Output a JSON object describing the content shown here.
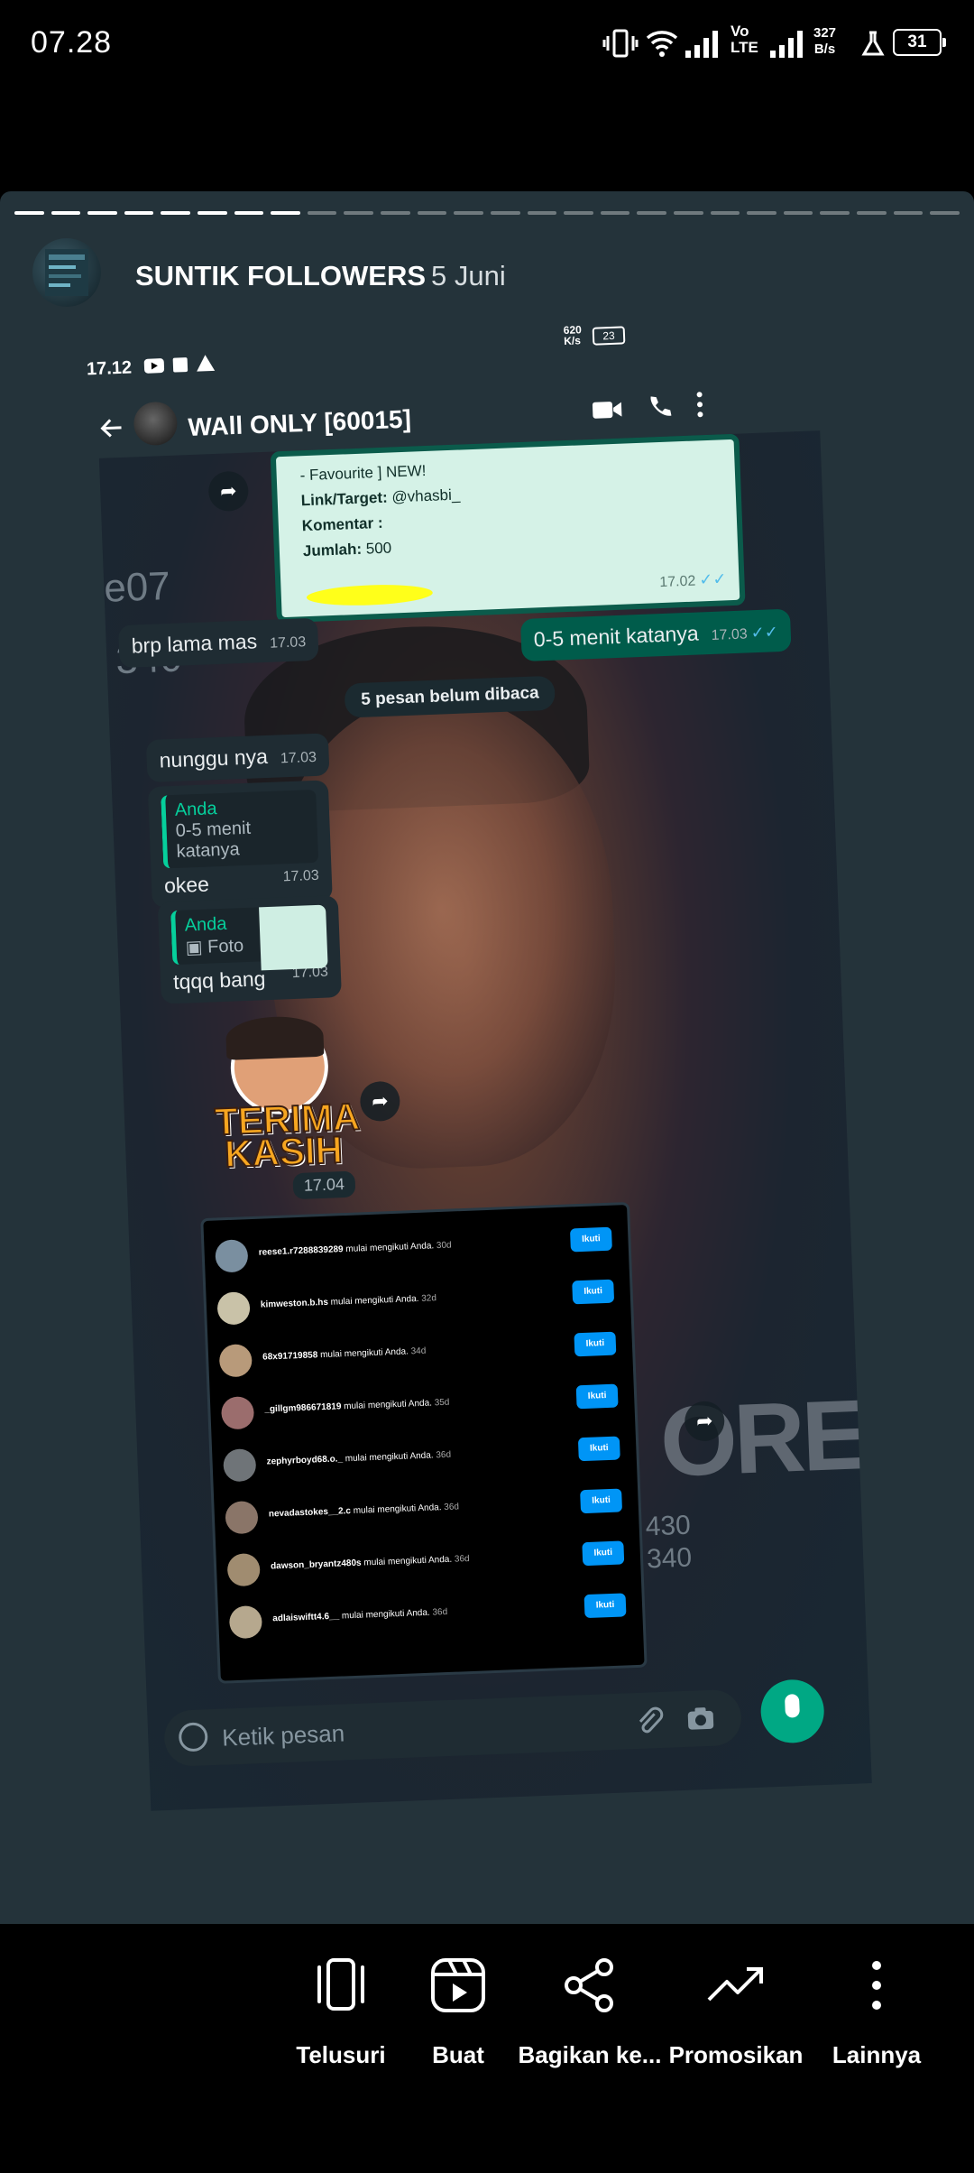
{
  "status_bar": {
    "time": "07.28",
    "net_speed_value": "327",
    "net_speed_unit": "B/s",
    "volte": "Vo\nLTE",
    "battery": "31"
  },
  "story": {
    "progress_total": 26,
    "progress_done": 8,
    "account_name": "SUNTIK FOLLOWERS",
    "date": "5 Juni"
  },
  "shot": {
    "status": {
      "time": "17.12",
      "battery": "23",
      "net_speed": "620\nK/s"
    },
    "chat_title": "WAll ONLY [60015]",
    "form": {
      "line1": "- Favourite ] NEW!",
      "target_label": "Link/Target:",
      "target_value": "@vhasbi_",
      "comment_label": "Komentar :",
      "amount_label": "Jumlah:",
      "amount_value": "500",
      "time": "17.02"
    },
    "messages": [
      {
        "dir": "in",
        "text": "brp lama mas",
        "time": "17.03"
      },
      {
        "dir": "out",
        "text": "0-5 menit katanya",
        "time": "17.03"
      }
    ],
    "unread_label": "5 pesan belum dibaca",
    "msg_nunggu": {
      "text": "nunggu nya",
      "time": "17.03"
    },
    "msg_okee": {
      "quote_who": "Anda",
      "quote_text": "0-5 menit katanya",
      "text": "okee",
      "time": "17.03"
    },
    "msg_tqqq": {
      "quote_who": "Anda",
      "quote_text": "Foto",
      "text": "tqqq bang",
      "time": "17.03"
    },
    "sticker_text_1": "TERIMA",
    "sticker_text_2": "KASIH",
    "sticker_time": "17.04",
    "bg_ghost_1": "e07",
    "bg_ghost_2": "340",
    "bg_ghost_3": "ORE",
    "bg_ghost_4": "430",
    "bg_ghost_5": "340",
    "followers": [
      {
        "user": "reese1.r7288839289",
        "text": "mulai mengikuti Anda.",
        "ago": "30d",
        "btn": "Ikuti",
        "color": "#7a8fa0"
      },
      {
        "user": "kimweston.b.hs",
        "text": "mulai mengikuti Anda.",
        "ago": "32d",
        "btn": "Ikuti",
        "color": "#c9c2a8"
      },
      {
        "user": "68x91719858",
        "text": "mulai mengikuti Anda.",
        "ago": "34d",
        "btn": "Ikuti",
        "color": "#b89a7a"
      },
      {
        "user": "_gillgm986671819",
        "text": "mulai mengikuti Anda.",
        "ago": "35d",
        "btn": "Ikuti",
        "color": "#9b6d6d"
      },
      {
        "user": "zephyrboyd68.o._",
        "text": "mulai mengikuti Anda.",
        "ago": "36d",
        "btn": "Ikuti",
        "color": "#6f7478"
      },
      {
        "user": "nevadastokes__2.c",
        "text": "mulai mengikuti Anda.",
        "ago": "36d",
        "btn": "Ikuti",
        "color": "#8a7568"
      },
      {
        "user": "dawson_bryantz480s",
        "text": "mulai mengikuti Anda.",
        "ago": "36d",
        "btn": "Ikuti",
        "color": "#a08c70"
      },
      {
        "user": "adlaiswiftt4.6__",
        "text": "mulai mengikuti Anda.",
        "ago": "36d",
        "btn": "Ikuti",
        "color": "#b6a88e"
      }
    ],
    "composer_placeholder": "Ketik pesan"
  },
  "bottom_actions": [
    {
      "label": "Telusuri",
      "icon": "swipe-phone-icon"
    },
    {
      "label": "Buat",
      "icon": "reels-play-icon"
    },
    {
      "label": "Bagikan ke...",
      "icon": "share-icon"
    },
    {
      "label": "Promosikan",
      "icon": "trending-up-icon"
    },
    {
      "label": "Lainnya",
      "icon": "more-vertical-icon"
    }
  ]
}
